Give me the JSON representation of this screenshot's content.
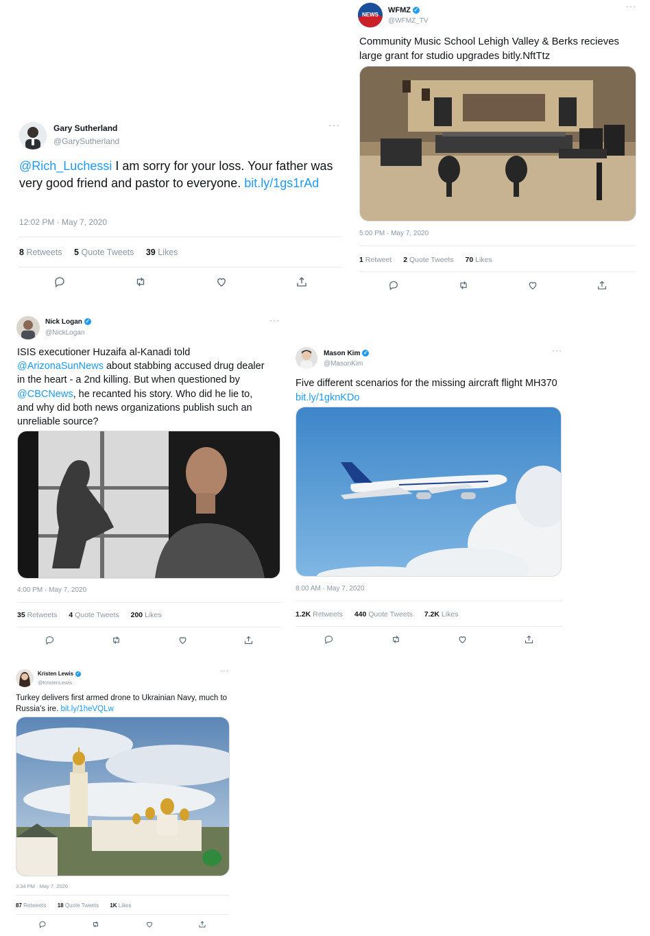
{
  "tweets": [
    {
      "id": "gary",
      "name": "Gary Sutherland",
      "handle": "@GarySutherland",
      "verified": false,
      "text_parts": [
        {
          "text": "@Rich_Luchessi",
          "link": true
        },
        {
          "text": " I am sorry for your loss. Your father was very good friend and pastor to everyone. ",
          "link": false
        },
        {
          "text": "bit.ly/1gs1rAd",
          "link": true
        }
      ],
      "timestamp": "12:02 PM · May 7, 2020",
      "retweets": "8",
      "retweets_label": "Retweets",
      "quotes": "5",
      "quotes_label": "Quote Tweets",
      "likes": "39",
      "likes_label": "Likes"
    },
    {
      "id": "wfmz",
      "name": "WFMZ",
      "handle": "@WFMZ_TV",
      "verified": true,
      "avatar_text": "NEWS",
      "text_parts": [
        {
          "text": "Community Music School Lehigh Valley & Berks recieves large grant for studio upgrades bitly.NftTtz",
          "link": false
        }
      ],
      "timestamp": "5:00 PM · May 7, 2020",
      "retweets": "1",
      "retweets_label": "Retweet",
      "quotes": "2",
      "quotes_label": "Quote Tweets",
      "likes": "70",
      "likes_label": "Likes"
    },
    {
      "id": "nick",
      "name": "Nick Logan",
      "handle": "@NickLogan",
      "verified": true,
      "text_parts": [
        {
          "text": "ISIS executioner Huzaifa al-Kanadi told ",
          "link": false
        },
        {
          "text": "@ArizonaSunNews",
          "link": true
        },
        {
          "text": " about stabbing accused drug dealer in the heart - a 2nd killing. But when questioned by ",
          "link": false
        },
        {
          "text": "@CBCNews",
          "link": true
        },
        {
          "text": ", he recanted his story. Who did he lie to, and why did both news organizations publish such an unreliable source?",
          "link": false
        }
      ],
      "timestamp": "4:00 PM · May 7, 2020",
      "retweets": "35",
      "retweets_label": "Retweets",
      "quotes": "4",
      "quotes_label": "Quote Tweets",
      "likes": "200",
      "likes_label": "Likes"
    },
    {
      "id": "mason",
      "name": "Mason Kim",
      "handle": "@MasonKim",
      "verified": true,
      "text_parts": [
        {
          "text": "Five different scenarios for the missing aircraft flight MH370 ",
          "link": false
        },
        {
          "text": "bit.ly/1gknKDo",
          "link": true
        }
      ],
      "timestamp": "8:00 AM · May 7, 2020",
      "retweets": "1.2K",
      "retweets_label": "Retweets",
      "quotes": "440",
      "quotes_label": "Quote Tweets",
      "likes": "7.2K",
      "likes_label": "Likes"
    },
    {
      "id": "kristen",
      "name": "Kristen Lewis",
      "handle": "@KristenLewis",
      "verified": true,
      "text_parts": [
        {
          "text": "Turkey delivers first armed drone to Ukrainian Navy, much to Russia's ire. ",
          "link": false
        },
        {
          "text": "bit.ly/1heVQLw",
          "link": true
        }
      ],
      "timestamp": "3:34 PM · May 7, 2020",
      "retweets": "87",
      "retweets_label": "Retweets",
      "quotes": "18",
      "quotes_label": "Quote Tweets",
      "likes": "1K",
      "likes_label": "Likes"
    }
  ],
  "icons": [
    "reply-icon",
    "retweet-icon",
    "like-icon",
    "share-icon",
    "verified-icon",
    "more-icon"
  ],
  "colors": {
    "link": "#1d9bf0",
    "muted": "#8b98a5",
    "text": "#0f1419",
    "divider": "#e6ecf0"
  }
}
